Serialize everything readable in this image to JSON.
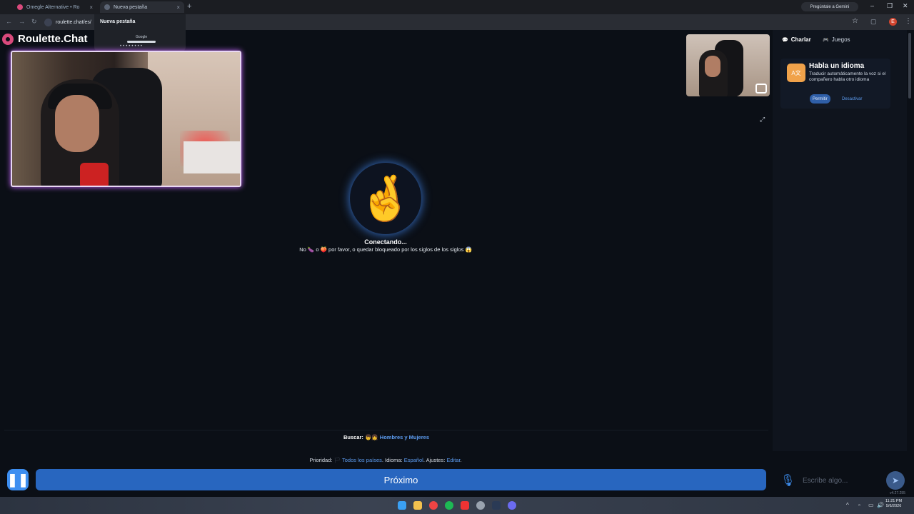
{
  "browser": {
    "tabs": [
      {
        "title": "Omegle Alternative • Ro"
      },
      {
        "title": "Nueva pestaña"
      }
    ],
    "newtab_glyph": "+",
    "gemini_label": "Pregúntale a Gemini",
    "url": "roulette.chat/es/",
    "dropdown_title": "Nueva pestaña",
    "dropdown_logo": "Google"
  },
  "site": {
    "brand_name": "Roulette.Chat"
  },
  "center": {
    "status_emoji": "🤞",
    "status_text": "Conectando...",
    "warning_prefix": "No",
    "warning_icon1": "🍆",
    "warning_mid": "o",
    "warning_icon2": "🍑",
    "warning_text": "por favor, o quedar bloqueado por los siglos de los siglos",
    "warning_icon3": "😱"
  },
  "search": {
    "label": "Buscar:",
    "emoji": "👦👧",
    "value": "Hombres y Mujeres"
  },
  "priority": {
    "label": "Prioridad:",
    "countries": "Todos los países",
    "language_label": "Idioma:",
    "language_value": "Español",
    "settings_label": "Ajustes:",
    "settings_link": "Editar"
  },
  "controls": {
    "pause_glyph": "❚❚",
    "next_label": "Próximo",
    "chat_placeholder": "Escribe algo...",
    "send_glyph": "➤",
    "version": "v4.27.255"
  },
  "right_panel": {
    "tabs": [
      {
        "label": "Charlar"
      },
      {
        "label": "Juegos"
      }
    ],
    "lang_card": {
      "title": "Habla un idioma",
      "description": "Traducir automáticamente la voz si el compañero habla otro idioma",
      "allow_label": "Permitir",
      "deny_label": "Desactivar"
    }
  },
  "system": {
    "time": "11:21 PM",
    "date": "5/6/2026"
  },
  "colors": {
    "accent_blue": "#2866bf",
    "brand_pink": "#d94a7c",
    "link": "#5d9df2"
  }
}
